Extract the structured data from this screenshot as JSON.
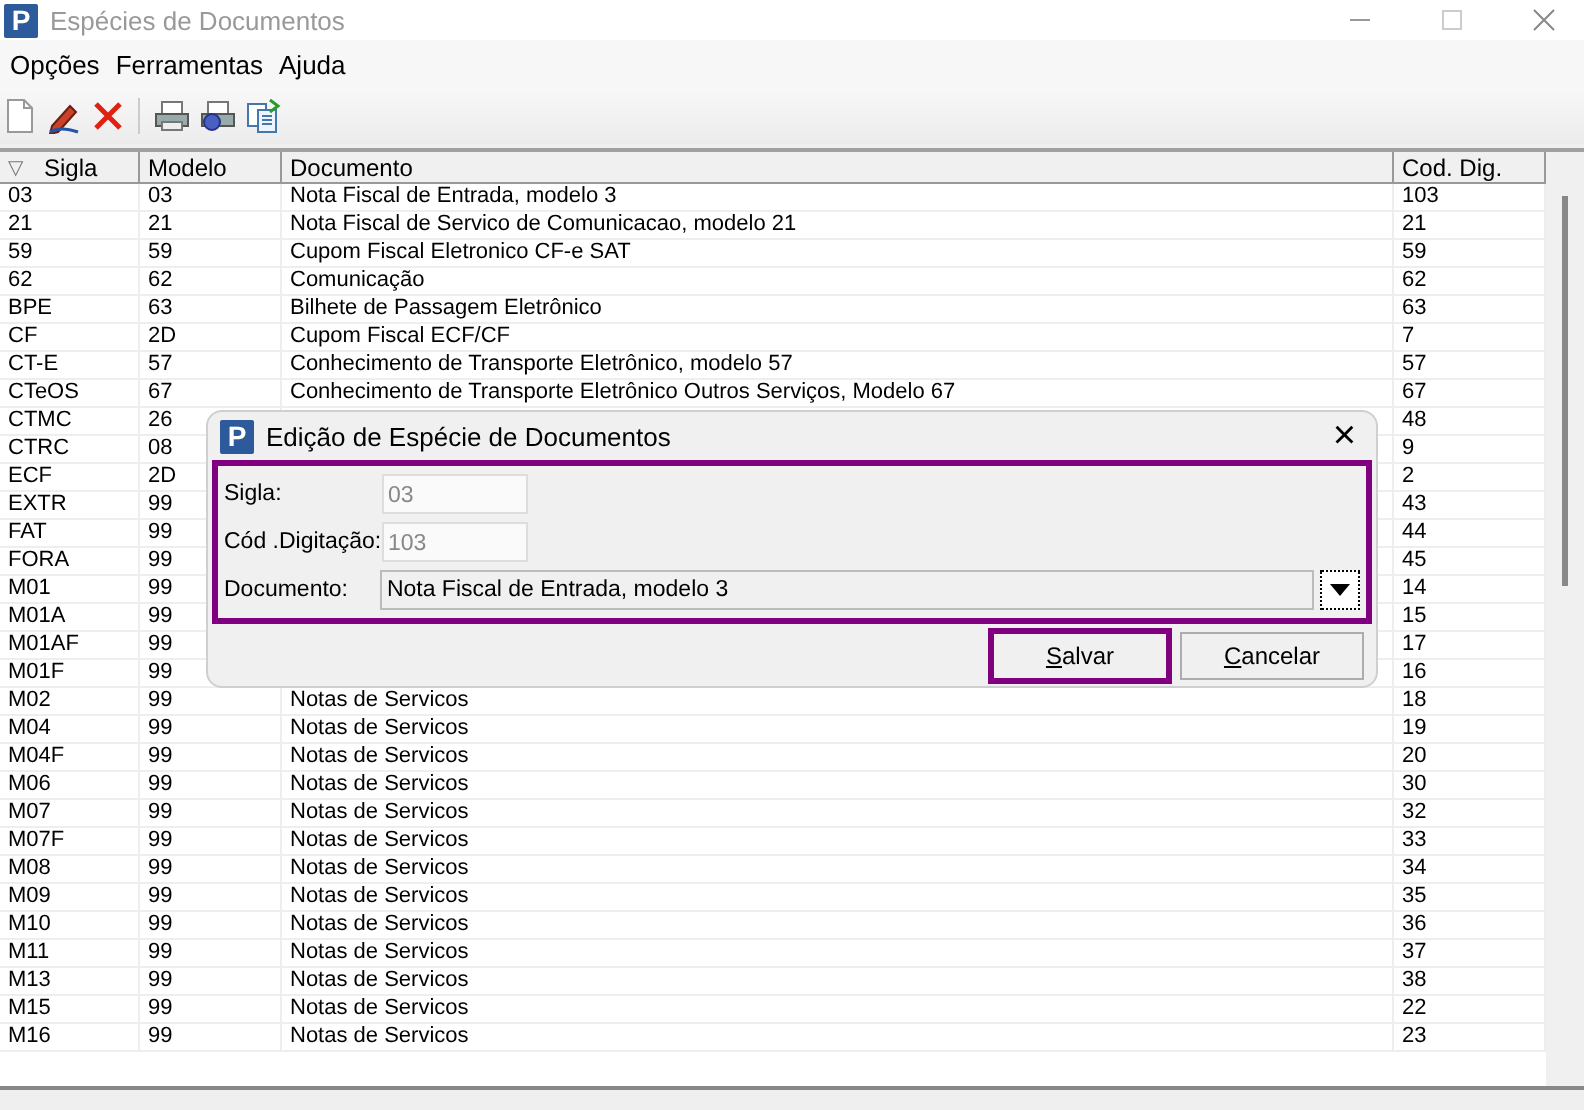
{
  "window": {
    "logo_letter": "P",
    "title": "Espécies de Documentos"
  },
  "menu": [
    "Opções",
    "Ferramentas",
    "Ajuda"
  ],
  "toolbar": [
    {
      "kind": "new"
    },
    {
      "kind": "edit"
    },
    {
      "kind": "delete"
    },
    {
      "kind": "separator"
    },
    {
      "kind": "print"
    },
    {
      "kind": "print-setup"
    },
    {
      "kind": "copy"
    }
  ],
  "table": {
    "sort_indicator": "▽",
    "columns": [
      "Sigla",
      "Modelo",
      "Documento",
      "Cod. Dig."
    ],
    "rows": [
      {
        "sigla": "03",
        "modelo": "03",
        "documento": "Nota Fiscal de Entrada, modelo 3",
        "cod_dig": "103"
      },
      {
        "sigla": "21",
        "modelo": "21",
        "documento": "Nota Fiscal de Servico de Comunicacao, modelo 21",
        "cod_dig": "21"
      },
      {
        "sigla": "59",
        "modelo": "59",
        "documento": "Cupom Fiscal Eletronico CF-e SAT",
        "cod_dig": "59"
      },
      {
        "sigla": "62",
        "modelo": "62",
        "documento": "Comunicação",
        "cod_dig": "62"
      },
      {
        "sigla": "BPE",
        "modelo": "63",
        "documento": "Bilhete de Passagem Eletrônico",
        "cod_dig": "63"
      },
      {
        "sigla": "CF",
        "modelo": "2D",
        "documento": "Cupom Fiscal ECF/CF",
        "cod_dig": "7"
      },
      {
        "sigla": "CT-E",
        "modelo": "57",
        "documento": "Conhecimento de Transporte Eletrônico, modelo 57",
        "cod_dig": "57"
      },
      {
        "sigla": "CTeOS",
        "modelo": "67",
        "documento": "Conhecimento de Transporte Eletrônico Outros Serviços, Modelo 67",
        "cod_dig": "67"
      },
      {
        "sigla": "CTMC",
        "modelo": "26",
        "cod_dig": "48"
      },
      {
        "sigla": "CTRC",
        "modelo": "08",
        "cod_dig": "9"
      },
      {
        "sigla": "ECF",
        "modelo": "2D",
        "cod_dig": "2"
      },
      {
        "sigla": "EXTR",
        "modelo": "99",
        "cod_dig": "43"
      },
      {
        "sigla": "FAT",
        "modelo": "99",
        "cod_dig": "44"
      },
      {
        "sigla": "FORA",
        "modelo": "99",
        "cod_dig": "45"
      },
      {
        "sigla": "M01",
        "modelo": "99",
        "cod_dig": "14"
      },
      {
        "sigla": "M01A",
        "modelo": "99",
        "cod_dig": "15"
      },
      {
        "sigla": "M01AF",
        "modelo": "99",
        "cod_dig": "17"
      },
      {
        "sigla": "M01F",
        "modelo": "99",
        "cod_dig": "16"
      },
      {
        "sigla": "M02",
        "modelo": "99",
        "documento": "Notas de Servicos",
        "cod_dig": "18"
      },
      {
        "sigla": "M04",
        "modelo": "99",
        "documento": "Notas de Servicos",
        "cod_dig": "19"
      },
      {
        "sigla": "M04F",
        "modelo": "99",
        "documento": "Notas de Servicos",
        "cod_dig": "20"
      },
      {
        "sigla": "M06",
        "modelo": "99",
        "documento": "Notas de Servicos",
        "cod_dig": "30"
      },
      {
        "sigla": "M07",
        "modelo": "99",
        "documento": "Notas de Servicos",
        "cod_dig": "32"
      },
      {
        "sigla": "M07F",
        "modelo": "99",
        "documento": "Notas de Servicos",
        "cod_dig": "33"
      },
      {
        "sigla": "M08",
        "modelo": "99",
        "documento": "Notas de Servicos",
        "cod_dig": "34"
      },
      {
        "sigla": "M09",
        "modelo": "99",
        "documento": "Notas de Servicos",
        "cod_dig": "35"
      },
      {
        "sigla": "M10",
        "modelo": "99",
        "documento": "Notas de Servicos",
        "cod_dig": "36"
      },
      {
        "sigla": "M11",
        "modelo": "99",
        "documento": "Notas de Servicos",
        "cod_dig": "37"
      },
      {
        "sigla": "M13",
        "modelo": "99",
        "documento": "Notas de Servicos",
        "cod_dig": "38"
      },
      {
        "sigla": "M15",
        "modelo": "99",
        "documento": "Notas de Servicos",
        "cod_dig": "22"
      },
      {
        "sigla": "M16",
        "modelo": "99",
        "documento": "Notas de Servicos",
        "cod_dig": "23"
      }
    ]
  },
  "dialog": {
    "logo_letter": "P",
    "title": "Edição de Espécie de Documentos",
    "close": "×",
    "fields_highlighted": true,
    "fields": [
      {
        "kind": "text",
        "label": "Sigla:",
        "value": "03",
        "disabled": true
      },
      {
        "kind": "text",
        "label": "Cód .Digitação:",
        "value": "103",
        "disabled": true
      },
      {
        "kind": "combo",
        "label": "Documento:",
        "value": "Nota Fiscal de Entrada, modelo 3",
        "disabled": false
      }
    ],
    "buttons": [
      {
        "label": "Salvar",
        "highlighted": true
      },
      {
        "label": "Cancelar",
        "highlighted": false
      }
    ]
  }
}
